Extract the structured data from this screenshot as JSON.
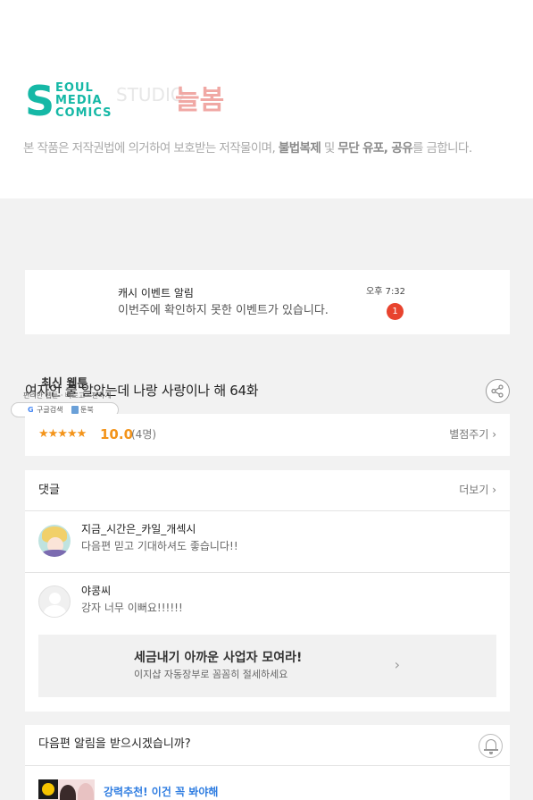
{
  "header": {
    "logo_letter": "S",
    "logo_lines": [
      "EOUL",
      "MEDIA",
      "COMICS"
    ],
    "studio_label": "STUDIO",
    "studio_name": "늘봄",
    "copyright_prefix": "본 작품은 저작권법에 의거하여 보호받는 저작물이며, ",
    "copyright_b1": "불법복제",
    "copyright_mid": " 및 ",
    "copyright_b2": "무단 유포, 공유",
    "copyright_suffix": "를 금합니다."
  },
  "notification": {
    "title": "캐시 이벤트 알림",
    "message": "이번주에 확인하지 못한 이벤트가 있습니다.",
    "time": "오후 7:32",
    "badge": "1"
  },
  "episode": {
    "title": "여자인 줄 알았는데 나랑 사랑이나 해 64화"
  },
  "overlay": {
    "title": "최신 웹툰",
    "subtitle": "편리한 웹툰 · 빠르고 · 편하게",
    "pill_google_letter": "G",
    "pill_google_label": "구글검색",
    "pill_book_label": "툰북"
  },
  "rating": {
    "stars": "★★★★★",
    "score": "10.0",
    "count": "(4명)",
    "rate_link": "별점주기 ›"
  },
  "comments": {
    "header": "댓글",
    "more": "더보기 ›",
    "items": [
      {
        "name": "지금_시간은_카일_개섹시",
        "text": "다음편 믿고 기대하셔도 좋습니다!!"
      },
      {
        "name": "야콩씨",
        "text": "강자 너무 이뻐요!!!!!!"
      }
    ]
  },
  "ad": {
    "title": "세금내기 아까운 사업자 모여라!",
    "subtitle": "이지샵 자동장부로 꼼꼼히 절세하세요",
    "chevron": "›"
  },
  "next_alert": {
    "question": "다음편 알림을 받으시겠습니까?",
    "recommend": "강력추천! 이건 꼭 봐야해"
  },
  "colors": {
    "brand_teal": "#15b8a6",
    "nulbom_pink": "#f0a8a4",
    "star_orange": "#f3941b",
    "badge_red": "#e8432e",
    "link_blue": "#2f7de1"
  }
}
